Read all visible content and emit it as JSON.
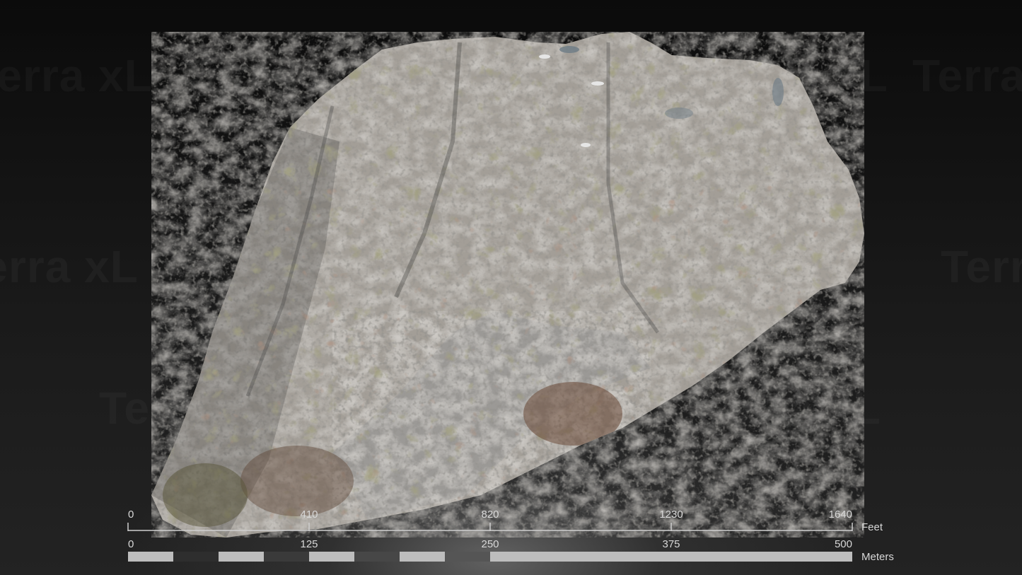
{
  "watermark": {
    "text": "Terra xL"
  },
  "scale_bar": {
    "feet": {
      "labels": [
        "0",
        "410",
        "820",
        "1230",
        "1640"
      ],
      "unit": "Feet"
    },
    "meters": {
      "labels": [
        "0",
        "125",
        "250",
        "375",
        "500"
      ],
      "unit": "Meters",
      "segment_colors": [
        "#bdbdbd",
        "#2e2e2e",
        "#bdbdbd",
        "#3a3a3a",
        "#bdbdbd",
        "#474747",
        "#bdbdbd",
        "#555555"
      ],
      "tail_color": "#bdbdbd"
    }
  },
  "colors": {
    "rock": "#a8a39c",
    "rock_dark": "#5c5a57",
    "lichen_green": "#5a5a3a",
    "lichen_brown": "#6e4a38",
    "scree": "#8f8f8f",
    "water": "#6b7a85"
  }
}
